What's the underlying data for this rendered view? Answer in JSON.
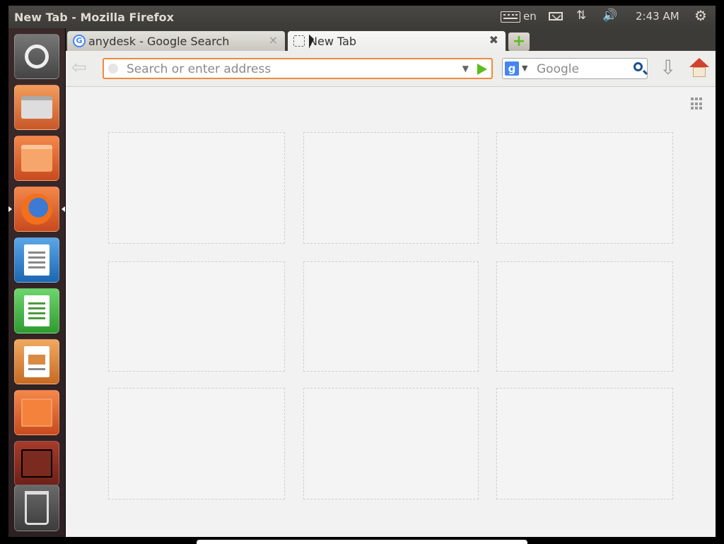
{
  "top_panel": {
    "window_title": "New Tab - Mozilla Firefox",
    "language": "en",
    "clock": "2:43 AM",
    "network_icon": "network-icon",
    "sound_icon": "volume-icon",
    "session_icon": "session-gear-icon"
  },
  "launcher": {
    "items": [
      "Dash Home",
      "Files",
      "Home Folder",
      "Firefox",
      "LibreOffice Writer",
      "LibreOffice Calc",
      "LibreOffice Impress",
      "Ubuntu Software Center",
      "Amazon",
      "Trash"
    ]
  },
  "tabs": [
    {
      "label": "anydesk - Google Search",
      "close": "×"
    },
    {
      "label": "New Tab",
      "close": "✖"
    }
  ],
  "new_tab_symbol": "+",
  "nav": {
    "url_placeholder": "Search or enter address",
    "url_dropdown": "▼",
    "search_engine_letter": "g",
    "search_dropdown": "▼",
    "search_placeholder": "Google",
    "back_symbol": "⇦",
    "downloads_symbol": "⇩"
  },
  "indicators": {
    "network_symbol": "⇅",
    "sound_symbol": "🔊",
    "session_symbol": "⚙"
  },
  "colors": {
    "url_focus_border": "#f08a3c",
    "go_arrow": "#5cbd1e",
    "panel_bg": "#3c3b37"
  },
  "tiles_count": 9
}
